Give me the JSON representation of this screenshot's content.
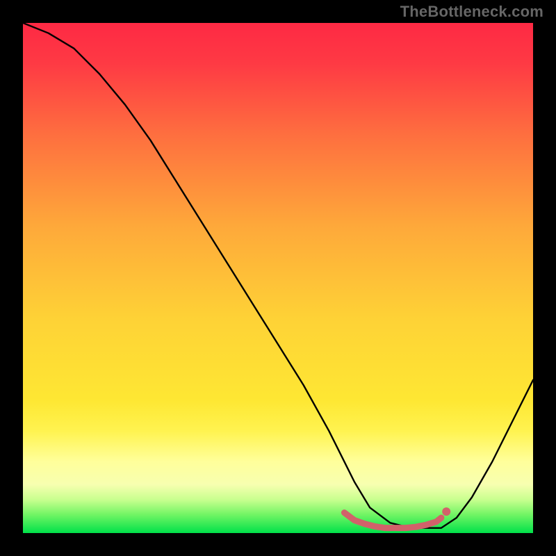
{
  "watermark": "TheBottleneck.com",
  "chart_data": {
    "type": "line",
    "title": "",
    "xlabel": "",
    "ylabel": "",
    "xlim": [
      0,
      100
    ],
    "ylim": [
      0,
      100
    ],
    "grid": false,
    "legend": false,
    "background_gradient": {
      "top": "#fe2944",
      "mid": "#fee733",
      "bottom": "#00e14a",
      "overlay_band": {
        "from_y": 80,
        "to_y": 92,
        "color": "#ffff9b"
      }
    },
    "series": [
      {
        "name": "bottleneck-curve",
        "color": "#000000",
        "x": [
          0,
          5,
          10,
          15,
          20,
          25,
          30,
          35,
          40,
          45,
          50,
          55,
          60,
          62,
          65,
          68,
          72,
          76,
          80,
          82,
          85,
          88,
          92,
          96,
          100
        ],
        "y": [
          100,
          98,
          95,
          90,
          84,
          77,
          69,
          61,
          53,
          45,
          37,
          29,
          20,
          16,
          10,
          5,
          2,
          1,
          1,
          1,
          3,
          7,
          14,
          22,
          30
        ]
      },
      {
        "name": "optimal-range",
        "color": "#d1626a",
        "marker": "dot",
        "x": [
          63,
          65,
          67,
          69,
          71,
          73,
          75,
          77,
          79,
          81,
          82
        ],
        "y": [
          4,
          2.5,
          1.8,
          1.3,
          1.0,
          1.0,
          1.0,
          1.2,
          1.6,
          2.2,
          3
        ]
      }
    ]
  }
}
